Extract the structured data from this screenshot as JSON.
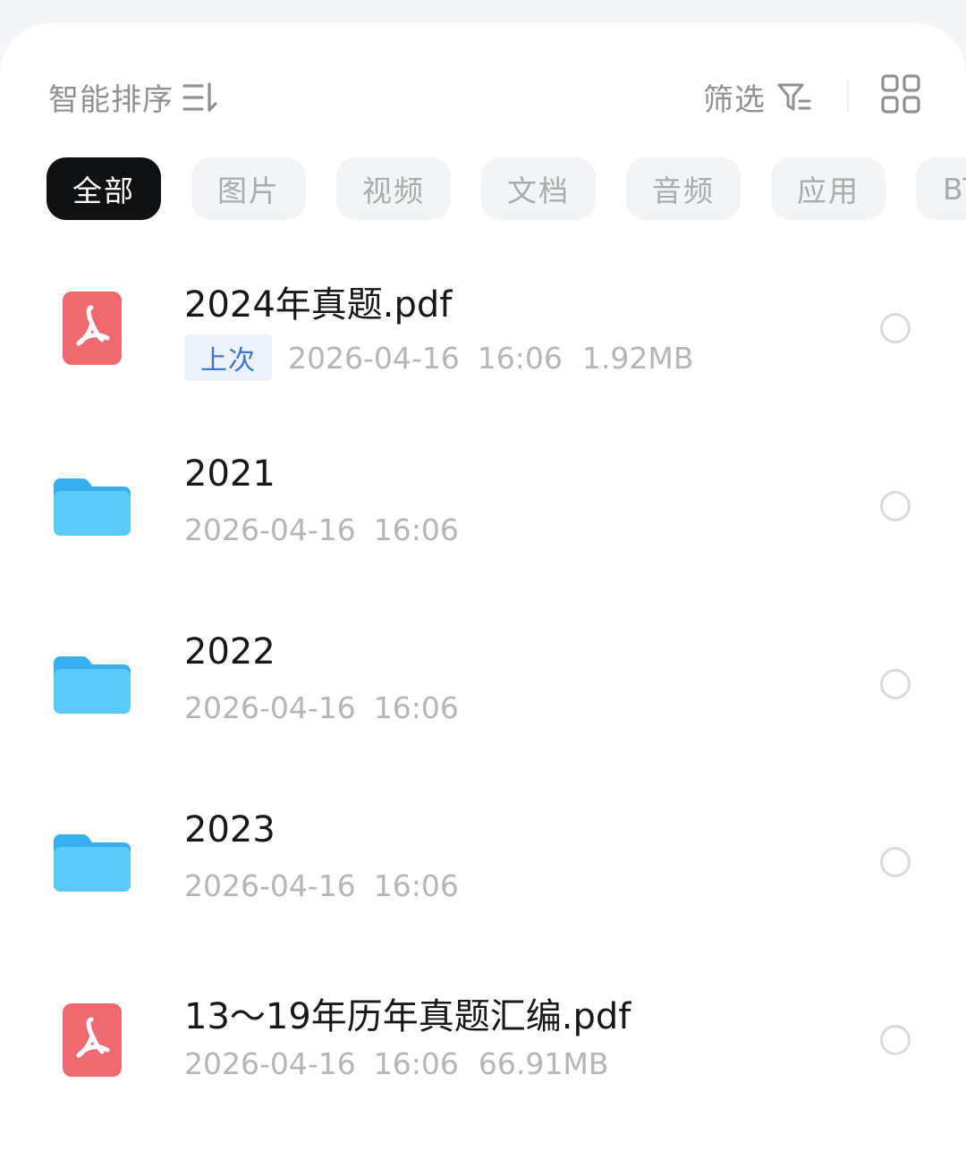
{
  "toolbar": {
    "sort_label": "智能排序",
    "sort_icon": "sort-lines-icon",
    "filter_label": "筛选",
    "filter_icon": "filter-funnel-icon",
    "view_toggle_icon": "grid-view-icon"
  },
  "category_chips": [
    {
      "label": "全部",
      "active": true
    },
    {
      "label": "图片",
      "active": false
    },
    {
      "label": "视频",
      "active": false
    },
    {
      "label": "文档",
      "active": false
    },
    {
      "label": "音频",
      "active": false
    },
    {
      "label": "应用",
      "active": false
    },
    {
      "label": "BT",
      "active": false
    }
  ],
  "files": [
    {
      "name": "2024年真题.pdf",
      "type": "pdf",
      "icon": "pdf-icon",
      "badge": "上次",
      "date": "2026-04-16",
      "time": "16:06",
      "size": "1.92MB"
    },
    {
      "name": "2021",
      "type": "folder",
      "icon": "folder-icon",
      "badge": "",
      "date": "2026-04-16",
      "time": "16:06",
      "size": ""
    },
    {
      "name": "2022",
      "type": "folder",
      "icon": "folder-icon",
      "badge": "",
      "date": "2026-04-16",
      "time": "16:06",
      "size": ""
    },
    {
      "name": "2023",
      "type": "folder",
      "icon": "folder-icon",
      "badge": "",
      "date": "2026-04-16",
      "time": "16:06",
      "size": ""
    },
    {
      "name": "13～19年历年真题汇编.pdf",
      "type": "pdf",
      "icon": "pdf-icon",
      "badge": "",
      "date": "2026-04-16",
      "time": "16:06",
      "size": "66.91MB"
    }
  ],
  "colors": {
    "active_chip_bg": "#0f1114",
    "pdf_red": "#ef6a70",
    "folder_blue": "#4fc3f7",
    "badge_blue": "#3b78d8"
  }
}
